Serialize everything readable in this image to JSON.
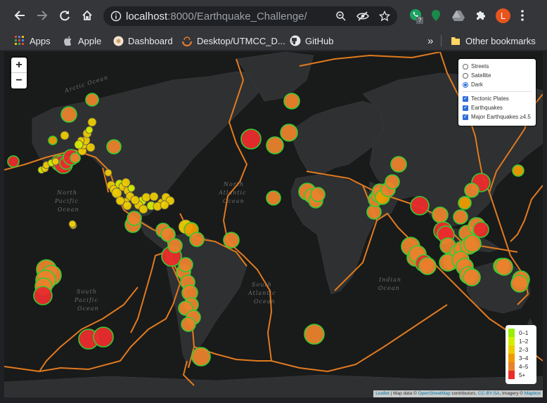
{
  "browser": {
    "url_scheme_host": "localhost",
    "url_rest": ":8000/Earthquake_Challenge/",
    "profile_initial": "L",
    "extension_badge": "?"
  },
  "bookmarks": {
    "items": [
      "Apps",
      "Apple",
      "Dashboard",
      "Desktop/UTMCC_D...",
      "GitHub"
    ],
    "overflow": "»",
    "other": "Other bookmarks"
  },
  "map": {
    "zoom_in": "+",
    "zoom_out": "−",
    "base_layers": [
      {
        "label": "Streets",
        "selected": false
      },
      {
        "label": "Satellite",
        "selected": false
      },
      {
        "label": "Dark",
        "selected": true
      }
    ],
    "overlays": [
      {
        "label": "Tectonic Plates",
        "checked": true
      },
      {
        "label": "Earthquakes",
        "checked": true
      },
      {
        "label": "Major Earthquakes ≥4.5",
        "checked": true
      }
    ],
    "legend": [
      {
        "label": "0–1",
        "color": "#98ee00"
      },
      {
        "label": "1–2",
        "color": "#d4ee00"
      },
      {
        "label": "2–3",
        "color": "#eecc00"
      },
      {
        "label": "3–4",
        "color": "#ee9c00"
      },
      {
        "label": "4–5",
        "color": "#ea822c"
      },
      {
        "label": "5+",
        "color": "#ea2c2c"
      }
    ],
    "attribution": {
      "leaflet": "Leaflet",
      "text1": " | Map data © ",
      "osm": "OpenStreetMap",
      "text2": " contributors, ",
      "license": "CC-BY-SA",
      "text3": ", Imagery © ",
      "mapbox": "Mapbox"
    },
    "ocean_labels": [
      {
        "text": "Arctic Ocean"
      },
      {
        "text": "North"
      },
      {
        "text": "Pacific"
      },
      {
        "text": "Ocean"
      },
      {
        "text": "North"
      },
      {
        "text": "Atlantic"
      },
      {
        "text": "Ocean"
      },
      {
        "text": "South"
      },
      {
        "text": "Pacific"
      },
      {
        "text": "Ocean"
      },
      {
        "text": "South"
      },
      {
        "text": "Atlantic"
      },
      {
        "text": "Ocean"
      },
      {
        "text": "Indian"
      },
      {
        "text": "Ocean"
      }
    ]
  }
}
